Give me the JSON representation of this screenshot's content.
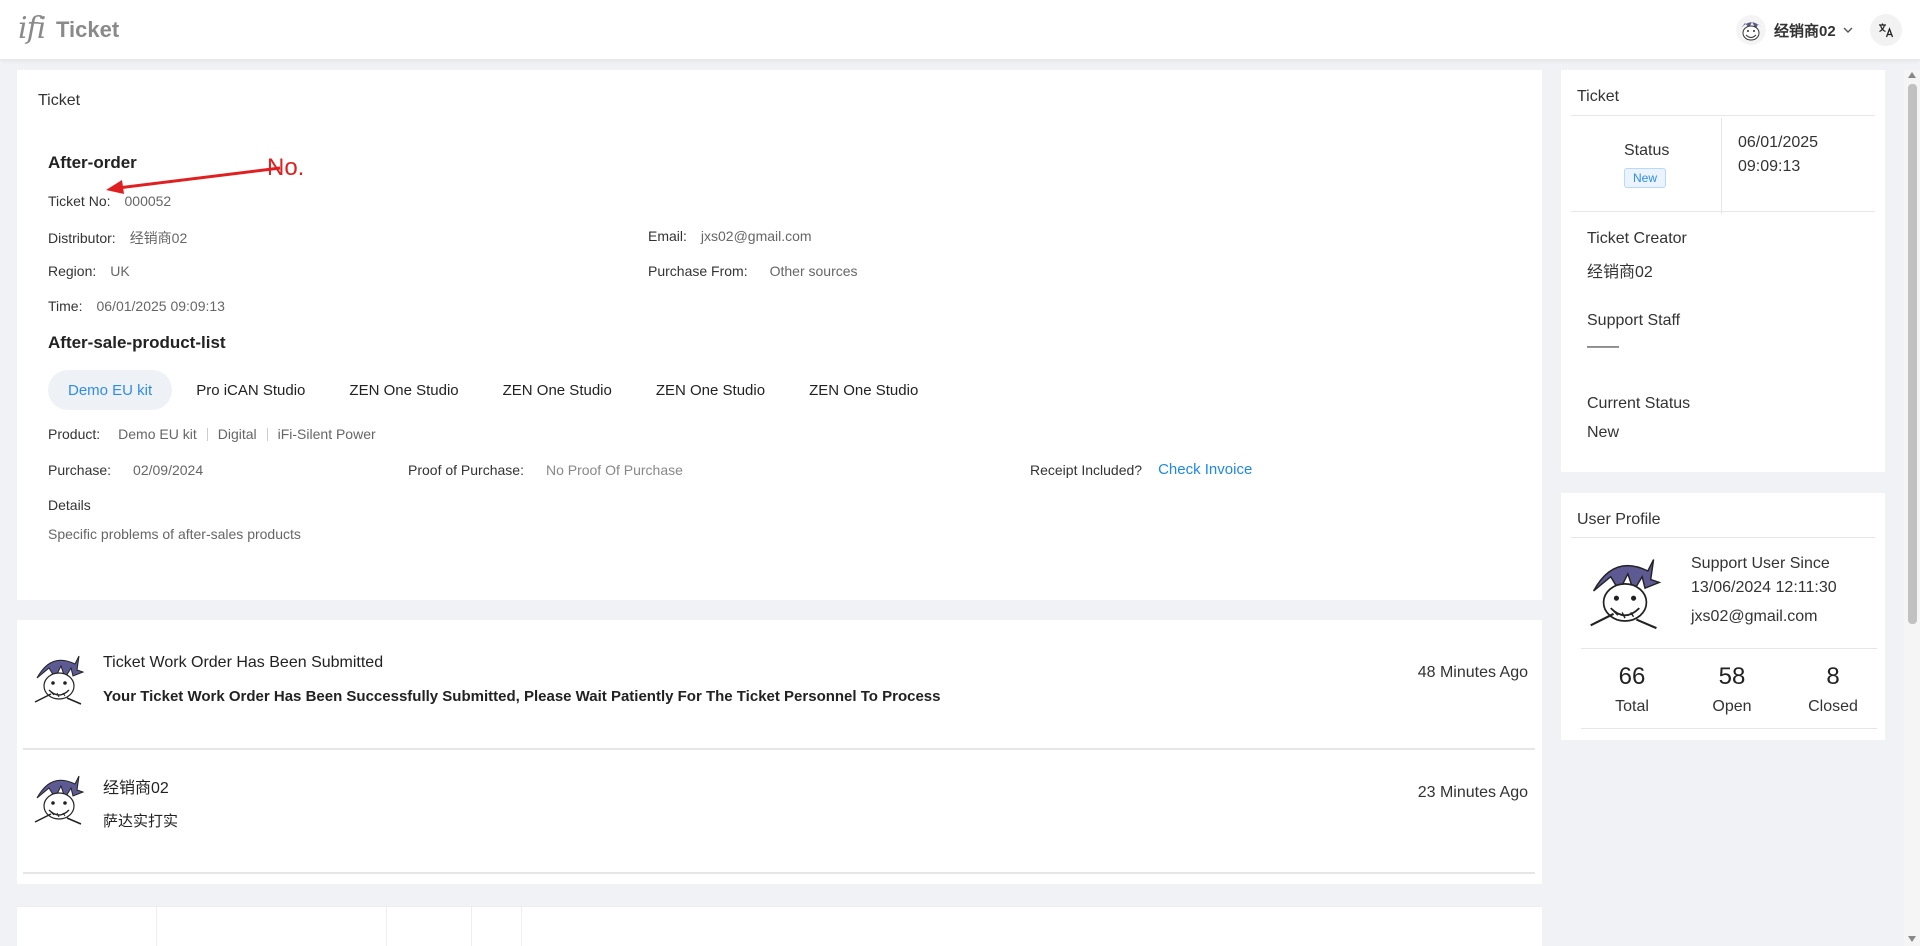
{
  "header": {
    "logo": "ifi",
    "brand": "Ticket",
    "user_name": "经销商02"
  },
  "ticket": {
    "panel_title": "Ticket",
    "section_after_order": "After-order",
    "annotation": "No.",
    "ticket_no_label": "Ticket No",
    "ticket_no": "000052",
    "distributor_label": "Distributor",
    "distributor": "经销商02",
    "email_label": "Email",
    "email": "jxs02@gmail.com",
    "region_label": "Region",
    "region": "UK",
    "purchase_from_label": "Purchase From",
    "purchase_from": "Other sources",
    "time_label": "Time",
    "time": "06/01/2025 09:09:13",
    "section_product_list": "After-sale-product-list",
    "product_tabs": [
      "Demo EU kit",
      "Pro iCAN Studio",
      "ZEN One Studio",
      "ZEN One Studio",
      "ZEN One Studio",
      "ZEN One Studio"
    ],
    "product_label": "Product",
    "product_values": [
      "Demo EU kit",
      "Digital",
      "iFi-Silent Power"
    ],
    "purchase_label": "Purchase",
    "purchase_date": "02/09/2024",
    "proof_label": "Proof of Purchase",
    "proof_value": "No Proof Of Purchase",
    "receipt_label": "Receipt Included?",
    "check_invoice": "Check Invoice",
    "details_label": "Details",
    "details_text": "Specific problems of after-sales products"
  },
  "timeline": [
    {
      "title": "Ticket Work Order Has Been Submitted",
      "body": "Your Ticket Work Order Has Been Successfully Submitted, Please Wait Patiently For The Ticket Personnel To Process",
      "time": "48 Minutes Ago"
    },
    {
      "title": "经销商02",
      "body": "萨达实打实",
      "time": "23 Minutes Ago"
    }
  ],
  "side_ticket": {
    "title": "Ticket",
    "status_label": "Status",
    "status_badge": "New",
    "date": "06/01/2025",
    "clock": "09:09:13",
    "creator_label": "Ticket Creator",
    "creator": "经销商02",
    "staff_label": "Support Staff",
    "staff": "——",
    "current_status_label": "Current Status",
    "current_status": "New"
  },
  "user_profile": {
    "title": "User Profile",
    "since_label": "Support User Since",
    "since": "13/06/2024 12:11:30",
    "email": "jxs02@gmail.com",
    "stats": [
      {
        "value": "66",
        "label": "Total"
      },
      {
        "value": "58",
        "label": "Open"
      },
      {
        "value": "8",
        "label": "Closed"
      }
    ]
  },
  "colors": {
    "accent": "#2f8de4",
    "link": "#1e88e5",
    "annotation": "#e02020"
  }
}
